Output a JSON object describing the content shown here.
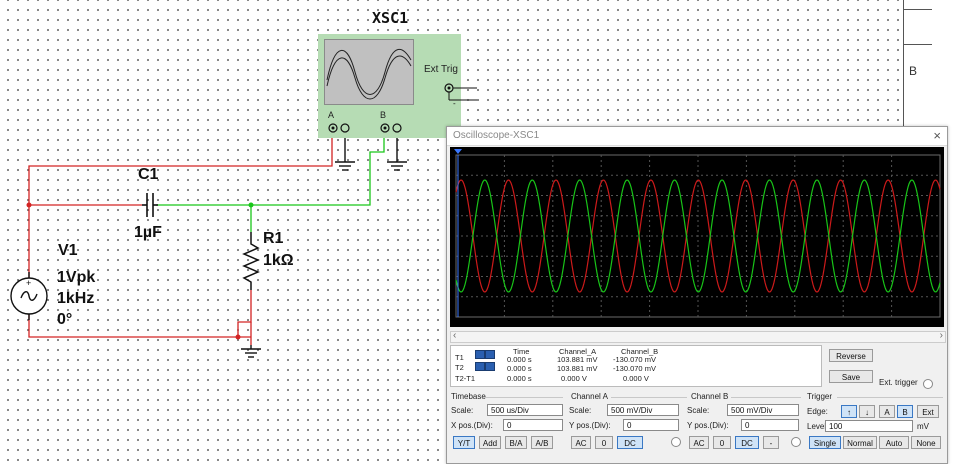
{
  "schematic": {
    "oscilloscope_ref": "XSC1",
    "oscilloscope_ext_trig_label": "Ext Trig",
    "oscilloscope_channel_a_label": "A",
    "oscilloscope_channel_b_label": "B",
    "capacitor_ref": "C1",
    "capacitor_value": "1µF",
    "resistor_ref": "R1",
    "resistor_value": "1kΩ",
    "source_ref": "V1",
    "source_amplitude": "1Vpk",
    "source_frequency": "1kHz",
    "source_phase": "0°",
    "sheet_border_letter": "B"
  },
  "scope_window": {
    "title": "Oscilloscope-XSC1",
    "close_glyph": "×",
    "trace_colors": {
      "channel_a": "#cc1a1a",
      "channel_b": "#18c418"
    },
    "readout": {
      "headers": [
        "Time",
        "Channel_A",
        "Channel_B"
      ],
      "row_labels": [
        "T1",
        "T2",
        "T2-T1"
      ],
      "rows": [
        [
          "0.000 s",
          "103.881 mV",
          "-130.070 mV"
        ],
        [
          "0.000 s",
          "103.881 mV",
          "-130.070 mV"
        ],
        [
          "0.000 s",
          "0.000 V",
          "0.000 V"
        ]
      ]
    },
    "reverse_button": "Reverse",
    "save_button": "Save",
    "ext_trigger_label": "Ext. trigger",
    "timebase": {
      "title": "Timebase",
      "scale_label": "Scale:",
      "scale_value": "500 us/Div",
      "xpos_label": "X pos.(Div):",
      "xpos_value": "0",
      "buttons": [
        "Y/T",
        "Add",
        "B/A",
        "A/B"
      ],
      "active_button": "Y/T"
    },
    "channel_a": {
      "title": "Channel A",
      "scale_label": "Scale:",
      "scale_value": "500 mV/Div",
      "ypos_label": "Y pos.(Div):",
      "ypos_value": "0",
      "buttons": [
        "AC",
        "0",
        "DC"
      ],
      "active_button": "DC"
    },
    "channel_b": {
      "title": "Channel B",
      "scale_label": "Scale:",
      "scale_value": "500 mV/Div",
      "ypos_label": "Y pos.(Div):",
      "ypos_value": "0",
      "buttons": [
        "AC",
        "0",
        "DC",
        "-"
      ],
      "active_button": "DC"
    },
    "trigger": {
      "title": "Trigger",
      "edge_label": "Edge:",
      "edge_buttons": [
        "↑",
        "↓",
        "A",
        "B",
        "Ext"
      ],
      "active_edge": "↑",
      "level_label": "Level:",
      "level_value": "100",
      "level_unit": "mV",
      "mode_buttons": [
        "Single",
        "Normal",
        "Auto",
        "None"
      ],
      "active_mode": "Single"
    }
  }
}
